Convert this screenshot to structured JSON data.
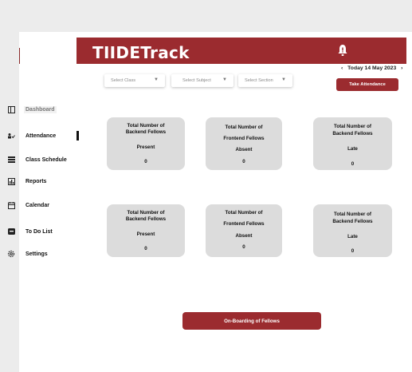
{
  "header": {
    "brand": "TIIDETrack",
    "bell_icon": "bell-icon"
  },
  "date": {
    "prev": "‹",
    "label": "Today 14 May 2023",
    "next": "›"
  },
  "take_attendance_label": "Take Attendance",
  "filters": [
    {
      "label": "Select Class",
      "caret": "▼"
    },
    {
      "label": "Select Subject",
      "caret": "▼"
    },
    {
      "label": "Select Section",
      "caret": "▼"
    }
  ],
  "sidebar": {
    "items": [
      {
        "label": "Dashboard",
        "icon": "dashboard-icon"
      },
      {
        "label": "Attendance",
        "icon": "attendance-icon"
      },
      {
        "label": "Class Schedule",
        "icon": "schedule-icon"
      },
      {
        "label": "Reports",
        "icon": "reports-icon"
      },
      {
        "label": "Calendar",
        "icon": "calendar-icon"
      },
      {
        "label": "To Do List",
        "icon": "todo-icon"
      },
      {
        "label": "Settings",
        "icon": "settings-icon"
      }
    ]
  },
  "cards_row1": [
    {
      "line1": "Total Number of",
      "line2": "Backend Fellows",
      "status": "Present",
      "value": "0"
    },
    {
      "line1": "Total Number of",
      "line2": "Frontend Fellows",
      "status": "Absent",
      "value": "0"
    },
    {
      "line1": "Total Number of",
      "line2": "Backend Fellows",
      "status": "Late",
      "value": "0"
    }
  ],
  "cards_row2": [
    {
      "line1": "Total Number of",
      "line2": "Backend Fellows",
      "status": "Present",
      "value": "0"
    },
    {
      "line1": "Total Number of",
      "line2": "Frontend Fellows",
      "status": "Absent",
      "value": "0"
    },
    {
      "line1": "Total Number of",
      "line2": "Backend Fellows",
      "status": "Late",
      "value": "0"
    }
  ],
  "onboarding_label": "On-Boarding of Fellows",
  "colors": {
    "brand": "#9b2b2f",
    "card": "#dcdcdc",
    "background": "#ececec"
  }
}
